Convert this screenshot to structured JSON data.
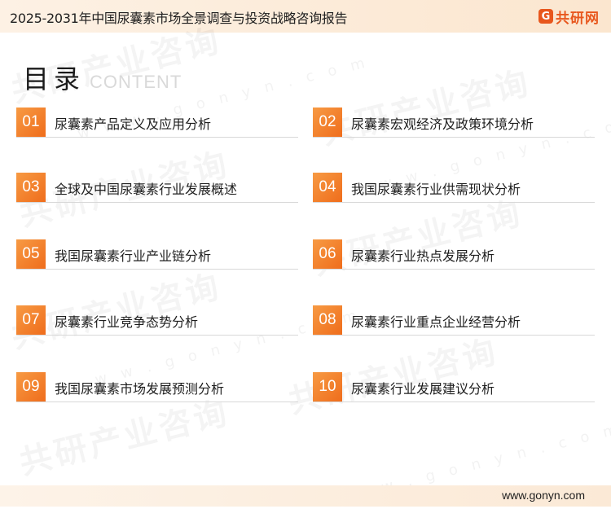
{
  "header": {
    "title": "2025-2031年中国尿囊素市场全景调查与投资战略咨询报告",
    "brand_mark": "G",
    "brand_name": "共研网"
  },
  "heading": {
    "main": "目录",
    "sub": "CONTENT"
  },
  "watermark": {
    "text": "共研产业咨询",
    "url": "w w w . g o n y n . c o m"
  },
  "toc": [
    {
      "num": "01",
      "label": "尿囊素产品定义及应用分析"
    },
    {
      "num": "02",
      "label": "尿囊素宏观经济及政策环境分析"
    },
    {
      "num": "03",
      "label": "全球及中国尿囊素行业发展概述"
    },
    {
      "num": "04",
      "label": "我国尿囊素行业供需现状分析"
    },
    {
      "num": "05",
      "label": "我国尿囊素行业产业链分析"
    },
    {
      "num": "06",
      "label": "尿囊素行业热点发展分析"
    },
    {
      "num": "07",
      "label": "尿囊素行业竞争态势分析"
    },
    {
      "num": "08",
      "label": "尿囊素行业重点企业经营分析"
    },
    {
      "num": "09",
      "label": "我国尿囊素市场发展预测分析"
    },
    {
      "num": "10",
      "label": "尿囊素行业发展建议分析"
    }
  ],
  "footer": {
    "url": "www.gonyn.com"
  },
  "colors": {
    "accent": "#ef6d1c",
    "brand": "#e8571d",
    "header_bg": "#fbe6cf"
  }
}
